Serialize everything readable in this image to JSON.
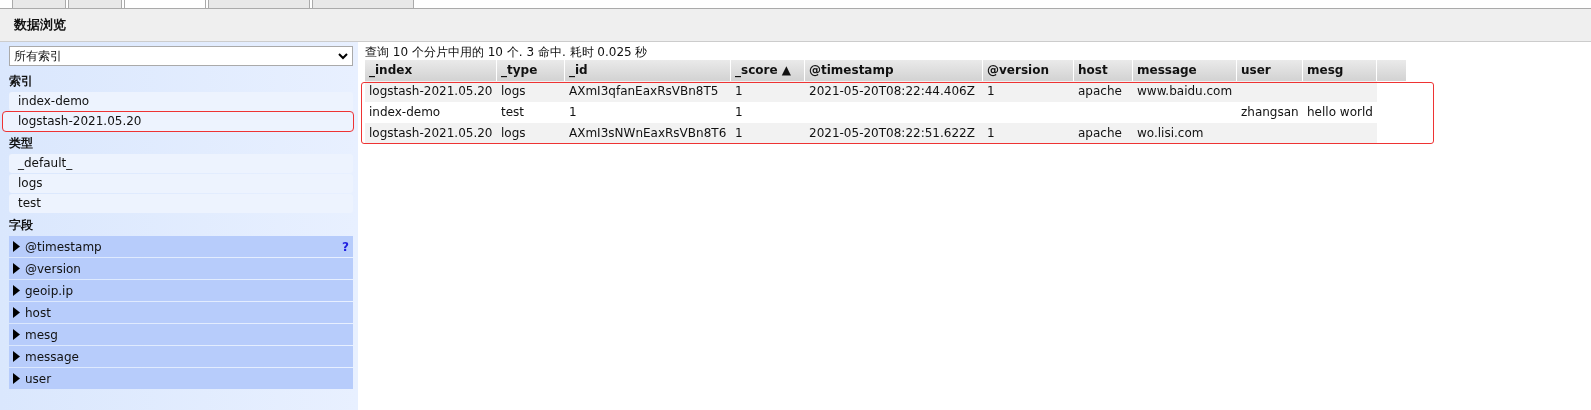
{
  "tabs": [
    {
      "selected": false
    },
    {
      "selected": false
    },
    {
      "selected": true
    },
    {
      "selected": false
    },
    {
      "selected": false
    }
  ],
  "page_title": "数据浏览",
  "sidebar": {
    "index_select": {
      "value": "所有索引"
    },
    "sections": [
      {
        "title": "索引",
        "kind": "list",
        "items": [
          {
            "label": "index-demo",
            "highlighted": false
          },
          {
            "label": "logstash-2021.05.20",
            "highlighted": true
          }
        ]
      },
      {
        "title": "类型",
        "kind": "list",
        "items": [
          {
            "label": "_default_",
            "highlighted": false
          },
          {
            "label": "logs",
            "highlighted": false
          },
          {
            "label": "test",
            "highlighted": false
          }
        ]
      },
      {
        "title": "字段",
        "kind": "fields",
        "items": [
          {
            "label": "@timestamp",
            "help": "?"
          },
          {
            "label": "@version"
          },
          {
            "label": "geoip.ip"
          },
          {
            "label": "host"
          },
          {
            "label": "mesg"
          },
          {
            "label": "message"
          },
          {
            "label": "user"
          }
        ]
      }
    ]
  },
  "summary": "查询 10 个分片中用的 10 个. 3 命中. 耗时 0.025 秒",
  "table": {
    "rows_highlighted": true,
    "columns": [
      {
        "label": "_index"
      },
      {
        "label": "_type"
      },
      {
        "label": "_id"
      },
      {
        "label": "_score",
        "sort": "▲"
      },
      {
        "label": "@timestamp"
      },
      {
        "label": "@version"
      },
      {
        "label": "host"
      },
      {
        "label": "message"
      },
      {
        "label": "user"
      },
      {
        "label": "mesg"
      }
    ],
    "rows": [
      [
        "logstash-2021.05.20",
        "logs",
        "AXmI3qfanEaxRsVBn8T5",
        "1",
        "2021-05-20T08:22:44.406Z",
        "1",
        "apache",
        "www.baidu.com",
        "",
        ""
      ],
      [
        "index-demo",
        "test",
        "1",
        "1",
        "",
        "",
        "",
        "",
        "zhangsan",
        "hello world"
      ],
      [
        "logstash-2021.05.20",
        "logs",
        "AXmI3sNWnEaxRsVBn8T6",
        "1",
        "2021-05-20T08:22:51.622Z",
        "1",
        "apache",
        "wo.lisi.com",
        "",
        ""
      ]
    ]
  }
}
